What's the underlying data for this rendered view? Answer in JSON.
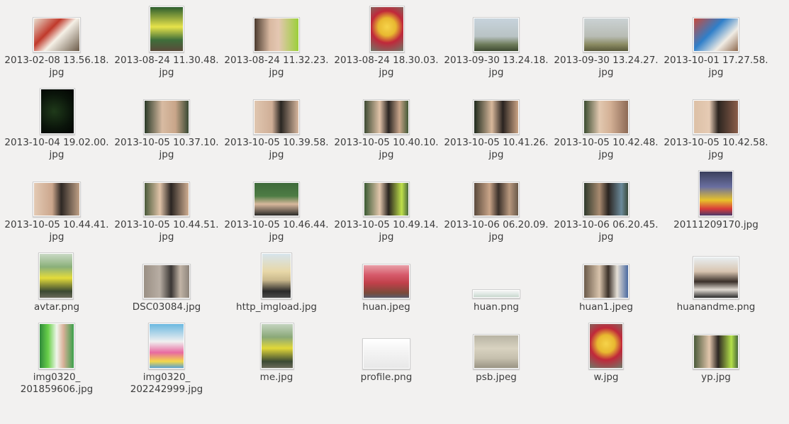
{
  "files": [
    {
      "l1": "2013-02-08 13.56.18.",
      "l2": "jpg",
      "bg": "linear-gradient(135deg,#e8dfd0 0%,#c0392b 35%,#f5f0e6 55%,#6b5a48 100%)"
    },
    {
      "l1": "2013-08-24 11.30.48.",
      "l2": "jpg",
      "bg": "linear-gradient(180deg,#2d5e2e 0%,#e7e34a 45%,#3f6e3a 75%,#5a4a3a 100%)"
    },
    {
      "l1": "2013-08-24 11.32.23.",
      "l2": "jpg",
      "bg": "linear-gradient(90deg,#4a3a2e 0%,#d9b9a1 35%,#e4c7b2 55%,#9ccf3a 100%)"
    },
    {
      "l1": "2013-08-24 18.30.03.",
      "l2": "jpg",
      "bg": "radial-gradient(circle at 50% 45%,#f6d34a 0%,#e8b830 30%,#c0283a 55%,#6e7a6a 100%)"
    },
    {
      "l1": "2013-09-30 13.24.18.",
      "l2": "jpg",
      "bg": "linear-gradient(180deg,#c7d3dc 0%,#b9c3c4 55%,#6d7b5a 80%,#3e4a32 100%)"
    },
    {
      "l1": "2013-09-30 13.24.27.",
      "l2": "jpg",
      "bg": "linear-gradient(180deg,#cbd2d4 0%,#b8bcb4 55%,#8a8a62 80%,#5a5a3c 100%)"
    },
    {
      "l1": "2013-10-01 17.27.58.",
      "l2": "jpg",
      "bg": "linear-gradient(135deg,#c84a3c 0%,#2f7fc9 40%,#f0ece4 70%,#8e6a4e 100%)"
    },
    {
      "l1": "2013-10-04 19.02.00.",
      "l2": "jpg",
      "bg": "radial-gradient(circle at 40% 50%,#1f3a1a 0%,#0a140a 60%,#020402 100%)"
    },
    {
      "l1": "2013-10-05 10.37.10.",
      "l2": "jpg",
      "bg": "linear-gradient(90deg,#2b3a28 0%,#d8bba2 40%,#c9a68a 70%,#3a4a34 100%)"
    },
    {
      "l1": "2013-10-05 10.39.58.",
      "l2": "jpg",
      "bg": "linear-gradient(90deg,#e0c6b0 0%,#cfae96 40%,#2a2622 60%,#d7b79e 100%)"
    },
    {
      "l1": "2013-10-05 10.40.10.",
      "l2": "jpg",
      "bg": "linear-gradient(90deg,#3d4a32 0%,#e0c2a8 35%,#2a2522 55%,#c8a58a 80%,#445a38 100%)"
    },
    {
      "l1": "2013-10-05 10.41.26.",
      "l2": "jpg",
      "bg": "linear-gradient(90deg,#1e2a1c 0%,#d8b89c 40%,#2a2320 65%,#c9a384 100%)"
    },
    {
      "l1": "2013-10-05 10.42.48.",
      "l2": "jpg",
      "bg": "linear-gradient(90deg,#3a4c30 0%,#e2c8b0 35%,#d3b095 60%,#8d6a56 100%)"
    },
    {
      "l1": "2013-10-05 10.42.58.",
      "l2": "jpg",
      "bg": "linear-gradient(90deg,#dcc0a6 0%,#e6cbb4 35%,#2c2520 55%,#8a5e4a 100%)"
    },
    {
      "l1": "2013-10-05 10.44.41.",
      "l2": "jpg",
      "bg": "linear-gradient(90deg,#e3cab4 0%,#cba68c 40%,#2e2824 60%,#bfa086 100%)"
    },
    {
      "l1": "2013-10-05 10.44.51.",
      "l2": "jpg",
      "bg": "linear-gradient(90deg,#4a5a3a 0%,#e0c3a8 35%,#2b2522 60%,#cfae92 100%)"
    },
    {
      "l1": "2013-10-05 10.46.44.",
      "l2": "jpg",
      "bg": "linear-gradient(180deg,#3e6a3a 0%,#4d7c44 40%,#d8b89c 65%,#2a2a28 100%)"
    },
    {
      "l1": "2013-10-05 10.49.14.",
      "l2": "jpg",
      "bg": "linear-gradient(90deg,#3a5a32 0%,#e2c6ac 35%,#2a2420 55%,#bfe04a 85%,#4a6a3c 100%)"
    },
    {
      "l1": "2013-10-06 06.20.09.",
      "l2": "jpg",
      "bg": "linear-gradient(90deg,#5a4a3c 0%,#c9a488 35%,#3a302a 55%,#b8987e 80%,#6a5a4a 100%)"
    },
    {
      "l1": "2013-10-06 06.20.45.",
      "l2": "jpg",
      "bg": "linear-gradient(90deg,#2e3a2c 0%,#a88a70 35%,#2a2420 55%,#6b8a9a 85%,#3a4a3a 100%)"
    },
    {
      "l1": "20111209170.jpg",
      "l2": "",
      "bg": "linear-gradient(180deg,#3a3f5c 0%,#6a6fa0 35%,#e8c22a 65%,#d83a3a 85%,#4a3a6a 100%)"
    },
    {
      "l1": "avtar.png",
      "l2": "",
      "bg": "linear-gradient(180deg,#c9d9c4 0%,#8ab07a 30%,#e4dc3a 55%,#3c4a32 85%,#6a6a5a 100%)"
    },
    {
      "l1": "DSC03084.jpg",
      "l2": "",
      "bg": "linear-gradient(90deg,#9a8f84 0%,#b8aea4 35%,#3a3634 60%,#c2b4a6 80%,#8e857c 100%)"
    },
    {
      "l1": "http_imgload.jpg",
      "l2": "",
      "bg": "linear-gradient(180deg,#d6e4ec 0%,#e8d8a8 40%,#c9b88c 60%,#2a2a2a 85%,#4a4a4a 100%)"
    },
    {
      "l1": "huan.jpeg",
      "l2": "",
      "bg": "linear-gradient(180deg,#e8a0a8 0%,#d65a6a 30%,#c0404a 55%,#7a4a3a 85%,#5a5a6a 100%)"
    },
    {
      "l1": "huan.png",
      "l2": "",
      "bg": "linear-gradient(180deg,#f4f4f4 0%,#dfe8e4 50%,#c9d7ce 100%)"
    },
    {
      "l1": "huan1.jpeg",
      "l2": "",
      "bg": "linear-gradient(90deg,#6a5a4a 0%,#d9c4ac 35%,#3a3028 55%,#e6e0d6 75%,#4a6aa0 100%)"
    },
    {
      "l1": "huanandme.png",
      "l2": "",
      "bg": "linear-gradient(180deg,#e8eef0 0%,#d8c4b0 35%,#3a302a 60%,#e0dad2 80%,#2a2a2a 100%)"
    },
    {
      "l1": "img0320_",
      "l2": "201859606.jpg",
      "bg": "linear-gradient(90deg,#2e8a3a 0%,#6ad04a 25%,#f0f6ec 50%,#d8b098 70%,#3aa04a 100%)"
    },
    {
      "l1": "img0320_",
      "l2": "202242999.jpg",
      "bg": "linear-gradient(180deg,#6ab8e0 0%,#f0f0f0 40%,#e86aa0 65%,#f4d84a 85%,#5aa0d0 100%)"
    },
    {
      "l1": "me.jpg",
      "l2": "",
      "bg": "linear-gradient(180deg,#c4d4c0 0%,#8aa878 30%,#e2d838 55%,#3c4a34 85%,#6a6a5a 100%)"
    },
    {
      "l1": "profile.png",
      "l2": "",
      "bg": "linear-gradient(180deg,#ffffff 0%,#f4f4f4 40%,#e8e8e8 100%)"
    },
    {
      "l1": "psb.jpeg",
      "l2": "",
      "bg": "linear-gradient(180deg,#b8b4a4 0%,#d8d2c0 40%,#c6c0ae 70%,#9a9484 100%)"
    },
    {
      "l1": "w.jpg",
      "l2": "",
      "bg": "radial-gradient(circle at 50% 45%,#f6d34a 0%,#e8b830 30%,#c0283a 55%,#6e7a6a 100%)"
    },
    {
      "l1": "yp.jpg",
      "l2": "",
      "bg": "linear-gradient(90deg,#4a5a3a 0%,#e2c6ac 35%,#2c2622 55%,#b4e04a 85%,#4a6a3c 100%)"
    }
  ]
}
